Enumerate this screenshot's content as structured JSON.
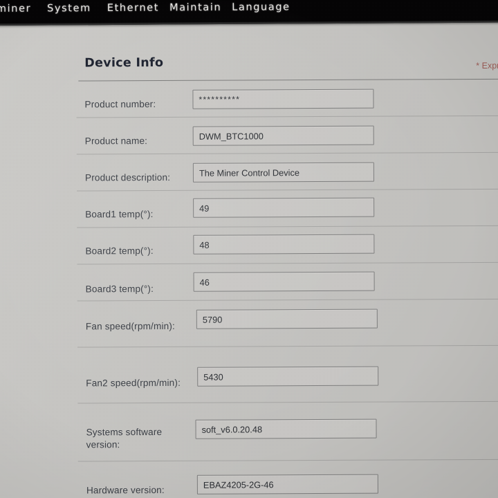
{
  "nav": {
    "items": [
      {
        "label": "gminer",
        "truncated": true
      },
      {
        "label": "System"
      },
      {
        "label": "Ethernet"
      },
      {
        "label": "Maintain"
      },
      {
        "label": "Language"
      }
    ]
  },
  "page": {
    "title": "Device Info",
    "required_note": "* Expr",
    "accent_red": "#9b5b55",
    "background": "#c9c8c5",
    "navbar_color": "#050405"
  },
  "form": {
    "rows": [
      {
        "label": "Product number:",
        "value": "**********",
        "masked": true
      },
      {
        "label": "Product name:",
        "value": "DWM_BTC1000"
      },
      {
        "label": "Product description:",
        "value": "The Miner Control Device"
      },
      {
        "label": "Board1 temp(°):",
        "value": "49"
      },
      {
        "label": "Board2 temp(°):",
        "value": "48"
      },
      {
        "label": "Board3 temp(°):",
        "value": "46"
      },
      {
        "label": "Fan speed(rpm/min):",
        "value": "5790"
      },
      {
        "label": "Fan2 speed(rpm/min):",
        "value": "5430"
      },
      {
        "label": "Systems software\nversion:",
        "value": "soft_v6.0.20.48"
      },
      {
        "label": "Hardware version:",
        "value": "EBAZ4205-2G-46"
      }
    ]
  }
}
